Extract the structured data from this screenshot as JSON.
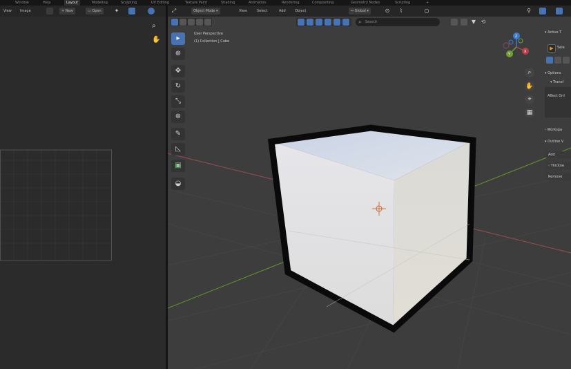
{
  "workspace_tabs": [
    {
      "label": "Window"
    },
    {
      "label": "Help"
    },
    {
      "label": "Layout",
      "active": true
    },
    {
      "label": "Modeling"
    },
    {
      "label": "Sculpting"
    },
    {
      "label": "UV Editing"
    },
    {
      "label": "Texture Paint"
    },
    {
      "label": "Shading"
    },
    {
      "label": "Animation"
    },
    {
      "label": "Rendering"
    },
    {
      "label": "Compositing"
    },
    {
      "label": "Geometry Nodes"
    },
    {
      "label": "Scripting"
    }
  ],
  "image_editor": {
    "menu_view": "View",
    "menu_image": "Image",
    "new_label": "New",
    "open_label": "Open"
  },
  "viewport": {
    "mode": "Object Mode",
    "menus": [
      "View",
      "Select",
      "Add",
      "Object"
    ],
    "transform_orientation": "Global",
    "search_placeholder": "Search",
    "info_line1": "User Perspective",
    "info_line2": "(1) Collection | Cube",
    "gizmo_labels": {
      "z": "Z",
      "x": "X",
      "y": "Y"
    }
  },
  "right_panel": {
    "active_tool": "Active T",
    "select": "Sele",
    "options": "Options",
    "transform": "Transf",
    "affect_only": "Affect Onl",
    "workspace": "Workspa",
    "outline": "Outline V",
    "add_btn": "Add",
    "thickness": "Thickne",
    "remove": "Remove"
  },
  "colors": {
    "accent": "#4772b3",
    "viewport_bg": "#3d3d3d",
    "axis_x": "#b4404a",
    "axis_y": "#6fa030",
    "axis_z": "#3a7bd5"
  }
}
